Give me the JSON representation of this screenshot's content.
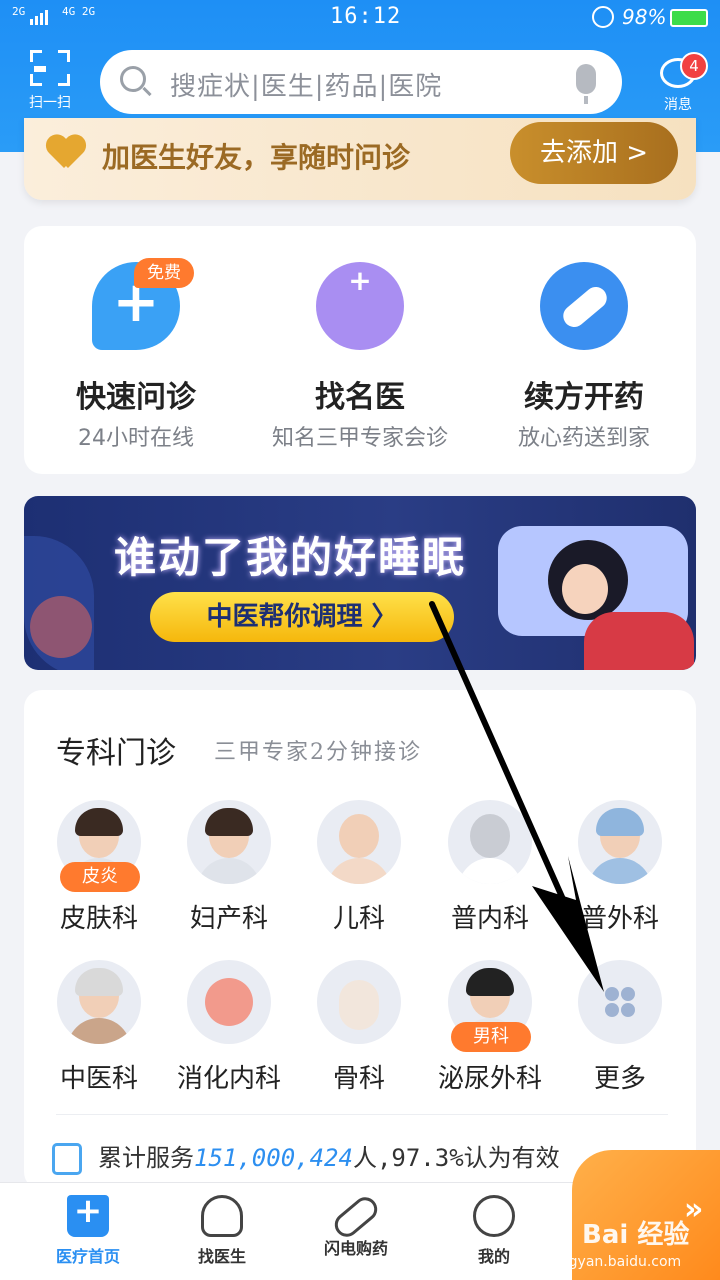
{
  "status_bar": {
    "signal_left": "2G",
    "signal_mid": "4G 2G",
    "time": "16:12",
    "battery": "98%"
  },
  "header": {
    "scan_label": "扫一扫",
    "search_placeholder": "搜症状|医生|药品|医院",
    "message_label": "消息",
    "message_badge": "4"
  },
  "promo": {
    "text": "加医生好友，享随时问诊",
    "button": "去添加 >"
  },
  "quick_services": [
    {
      "title": "快速问诊",
      "subtitle": "24小时在线",
      "tag": "免费",
      "icon": "chat-plus-icon"
    },
    {
      "title": "找名医",
      "subtitle": "知名三甲专家会诊",
      "icon": "nurse-icon"
    },
    {
      "title": "续方开药",
      "subtitle": "放心药送到家",
      "icon": "pill-icon"
    }
  ],
  "banner": {
    "title": "谁动了我的好睡眠",
    "cta": "中医帮你调理 〉"
  },
  "departments": {
    "header": "专科门诊",
    "header_sub": "三甲专家2分钟接诊",
    "items": [
      {
        "label": "皮肤科",
        "tag": "皮炎"
      },
      {
        "label": "妇产科"
      },
      {
        "label": "儿科"
      },
      {
        "label": "普内科"
      },
      {
        "label": "普外科"
      },
      {
        "label": "中医科"
      },
      {
        "label": "消化内科"
      },
      {
        "label": "骨科"
      },
      {
        "label": "泌尿外科",
        "tag": "男科"
      },
      {
        "label": "更多"
      }
    ]
  },
  "stats": {
    "prefix": "累计服务",
    "number": "151,000,424",
    "suffix": "人,97.3%认为有效"
  },
  "tabbar": {
    "items": [
      {
        "label": "医疗首页",
        "icon": "home-plus-icon",
        "active": true
      },
      {
        "label": "找医生",
        "icon": "doctor-icon"
      },
      {
        "label": "闪电购药",
        "icon": "pill-icon"
      },
      {
        "label": "我的",
        "icon": "person-icon"
      }
    ]
  },
  "watermark": {
    "text": "Bai 经验",
    "url": "jingyan.baidu.com"
  },
  "colors": {
    "primary": "#2a8ff2",
    "accent_orange": "#ff7a2e",
    "promo_gold": "#a86f1e"
  }
}
